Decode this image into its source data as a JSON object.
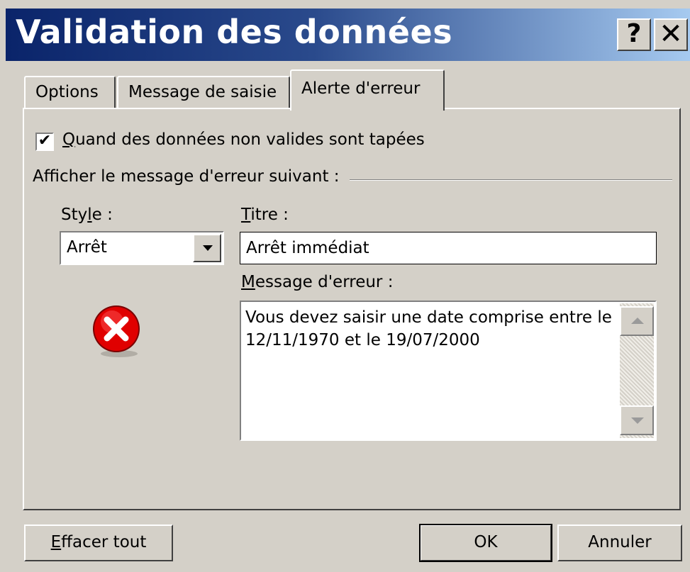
{
  "window": {
    "title": "Validation des données",
    "help_label": "?",
    "close_label": "✕"
  },
  "tabs": [
    {
      "label": "Options",
      "active": false
    },
    {
      "label": "Message de saisie",
      "active": false
    },
    {
      "label": "Alerte d'erreur",
      "active": true
    }
  ],
  "alert": {
    "show_alert_checked": true,
    "show_alert_label_prefix": "Q",
    "show_alert_label_rest": "uand des données non valides sont tapées",
    "section_label": "Afficher le message d'erreur suivant :",
    "style_label_a": "Sty",
    "style_label_u": "l",
    "style_label_b": "e :",
    "style_value": "Arrêt",
    "style_icon": "error-stop-icon",
    "titre_label_u": "T",
    "titre_label_rest": "itre :",
    "titre_value": "Arrêt immédiat",
    "message_label_u": "M",
    "message_label_rest": "essage d'erreur :",
    "message_value": "Vous devez saisir une date comprise entre le\n12/11/1970 et le 19/07/2000"
  },
  "buttons": {
    "clear_u": "E",
    "clear_rest": "ffacer tout",
    "ok": "OK",
    "cancel": "Annuler"
  },
  "colors": {
    "titlebar_start": "#0a246a",
    "titlebar_end": "#a6caf0",
    "dialog_bg": "#d4d0c8",
    "error_red": "#e00000"
  }
}
